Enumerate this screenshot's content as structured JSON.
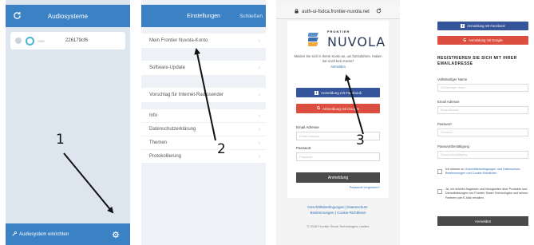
{
  "screen1": {
    "title": "Audiosysteme",
    "device_id": "226179cf6",
    "device_sub": "SMR",
    "footer_label": "Audiosystem einrichten"
  },
  "screen2": {
    "title": "Einstellungen",
    "close_label": "Schließen",
    "items": [
      "Mein Frontier Nuvola-Konto",
      "Software-Update",
      "Vorschlag für Internet-Radiosender",
      "Info",
      "Datenschutzerklärung",
      "Themen",
      "Protokollierung"
    ]
  },
  "screen3": {
    "url": "auth-ui-fsdca.frontier-nuvola.net",
    "logo_small": "FRONTIER",
    "logo_large": "NUVOLA",
    "intro": "Melden Sie sich in Ihrem Konto an, um fortzufahren. Haben Sie noch kein Konto?",
    "login_link": "Anmelden",
    "facebook_label": "Anmeldung mit Facebook",
    "google_label": "Anmeldung mit Google",
    "email_label": "Email Adresse",
    "email_placeholder": "Email Adresse",
    "password_label": "Passwort",
    "password_placeholder": "Passwort",
    "submit_label": "Anmeldung",
    "forgot_label": "Passwort vergessen?",
    "footer_links_1": "Geschäftsbedingungen | Datenschutz-",
    "footer_links_2": "Bestimmungen | Cookie-Richtlinien",
    "copyright": "© 2018 Frontier Smart Technologies Limited"
  },
  "screen4": {
    "facebook_label": "Anmeldung mit Facebook",
    "google_label": "Anmeldung mit Google",
    "heading": "REGISTRIEREN SIE SICH MIT IHRER EMAILADRESSE",
    "name_label": "Vollständiger Name",
    "name_placeholder": "Vollständiger Name",
    "email_label": "Email Adresse",
    "email_placeholder": "Email Adresse",
    "password_label": "Passwort",
    "password_placeholder": "Passwort",
    "confirm_label": "Passwortbestätigung",
    "confirm_placeholder": "Passwortbestätigung",
    "terms_prefix": "Ich stimme zu ",
    "terms_link": "Geschäftsbedingungen und Datenschutz-Bestimmungen und Cookie-Richtlinien",
    "marketing_text": "Ja, ich möchte Angebote und Neuigkeiten über Produkte und Dienstleistungen von Frontier Smart Technologies und seinen Partnern per E-Mail erhalten.",
    "submit_label": "Anmelden"
  },
  "steps": [
    "1",
    "2",
    "3"
  ],
  "colors": {
    "app_blue": "#3b82c4",
    "facebook": "#35549a",
    "google": "#dc4e3f",
    "button_dark": "#4a4a4a",
    "link": "#2e6eb5"
  }
}
